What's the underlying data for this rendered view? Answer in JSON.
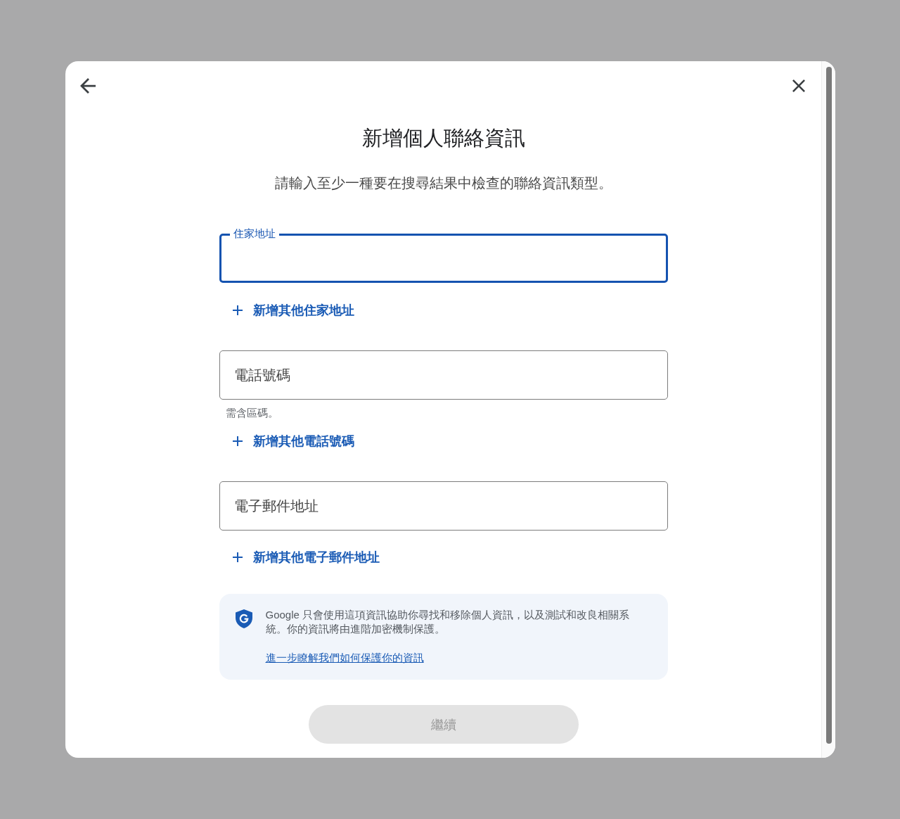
{
  "dialog": {
    "title": "新增個人聯絡資訊",
    "subtitle": "請輸入至少一種要在搜尋結果中檢查的聯絡資訊類型。"
  },
  "fields": [
    {
      "label": "住家地址",
      "focused": true,
      "add_more": "新增其他住家地址"
    },
    {
      "label": "電話號碼",
      "focused": false,
      "helper": "需含區碼。",
      "add_more": "新增其他電話號碼"
    },
    {
      "label": "電子郵件地址",
      "focused": false,
      "add_more": "新增其他電子郵件地址"
    }
  ],
  "notice": {
    "text": "Google 只會使用這項資訊協助你尋找和移除個人資訊，以及測試和改良相關系統。你的資訊將由進階加密機制保護。",
    "link": "進一步瞭解我們如何保護你的資訊"
  },
  "continue_button": {
    "label": "繼續",
    "disabled": true
  }
}
